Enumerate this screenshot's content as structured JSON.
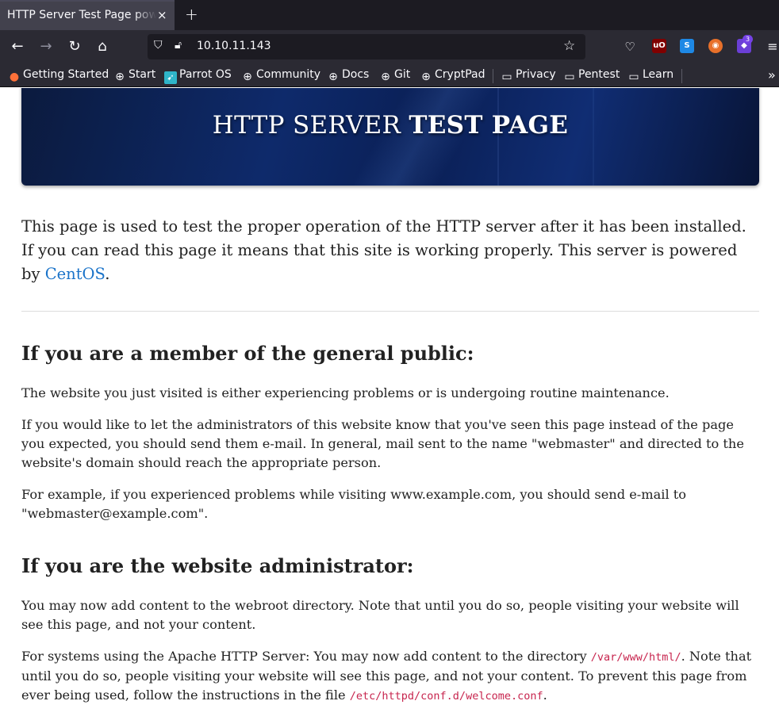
{
  "browser": {
    "tab_title": "HTTP Server Test Page powered by CentOS",
    "tab_close": "×",
    "new_tab": "+",
    "url": "10.10.11.143",
    "extension_badge": "3",
    "bookmarks": [
      {
        "label": "Getting Started",
        "icon": "firefox-icon"
      },
      {
        "label": "Start",
        "icon": "globe-icon"
      },
      {
        "label": "Parrot OS",
        "icon": "parrot-icon"
      },
      {
        "label": "Community",
        "icon": "globe-icon"
      },
      {
        "label": "Docs",
        "icon": "globe-icon"
      },
      {
        "label": "Git",
        "icon": "globe-icon"
      },
      {
        "label": "CryptPad",
        "icon": "globe-icon"
      },
      {
        "label": "Privacy",
        "icon": "folder-icon"
      },
      {
        "label": "Pentest",
        "icon": "folder-icon"
      },
      {
        "label": "Learn",
        "icon": "folder-icon"
      }
    ]
  },
  "page": {
    "banner_title_light": "HTTP SERVER",
    "banner_title_bold": "TEST PAGE",
    "intro_before_link": "This page is used to test the proper operation of the HTTP server after it has been installed. If you can read this page it means that this site is working properly. This server is powered by ",
    "intro_link": "CentOS",
    "intro_after_link": ".",
    "public": {
      "heading": "If you are a member of the general public:",
      "p1": "The website you just visited is either experiencing problems or is undergoing routine maintenance.",
      "p2": "If you would like to let the administrators of this website know that you've seen this page instead of the page you expected, you should send them e-mail. In general, mail sent to the name \"webmaster\" and directed to the website's domain should reach the appropriate person.",
      "p3": "For example, if you experienced problems while visiting www.example.com, you should send e-mail to \"webmaster@example.com\"."
    },
    "admin": {
      "heading": "If you are the website administrator:",
      "p1": "You may now add content to the webroot directory. Note that until you do so, people visiting your website will see this page, and not your content.",
      "p2_a": "For systems using the Apache HTTP Server: You may now add content to the directory ",
      "p2_code1": "/var/www/html/",
      "p2_b": ". Note that until you do so, people visiting your website will see this page, and not your content. To prevent this page from ever being used, follow the instructions in the file ",
      "p2_code2": "/etc/httpd/conf.d/welcome.conf",
      "p2_c": "."
    }
  }
}
